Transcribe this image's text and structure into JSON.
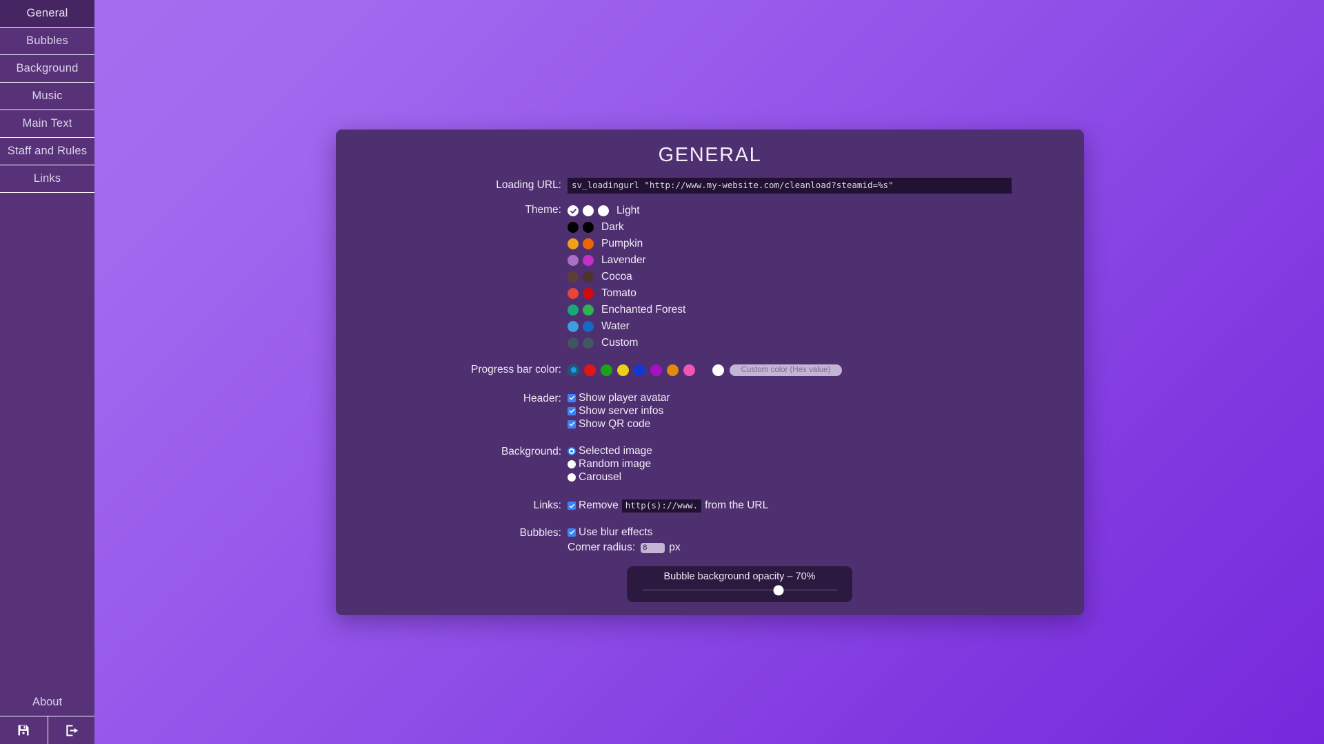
{
  "sidebar": {
    "items": [
      {
        "label": "General",
        "active": true
      },
      {
        "label": "Bubbles",
        "active": false
      },
      {
        "label": "Background",
        "active": false
      },
      {
        "label": "Music",
        "active": false
      },
      {
        "label": "Main Text",
        "active": false
      },
      {
        "label": "Staff and Rules",
        "active": false
      },
      {
        "label": "Links",
        "active": false
      }
    ],
    "about_label": "About",
    "buttons": [
      {
        "icon": "save-icon",
        "name": "save-button"
      },
      {
        "icon": "exit-icon",
        "name": "exit-button"
      }
    ]
  },
  "panel": {
    "title": "GENERAL",
    "loading_url": {
      "label": "Loading URL:",
      "value": "sv_loadingurl \"http://www.my-website.com/cleanload?steamid=%s\""
    },
    "theme": {
      "label": "Theme:",
      "options": [
        {
          "name": "Light",
          "selected": true,
          "colors": [
            "#ffffff",
            "#ffffff",
            "#ffffff"
          ]
        },
        {
          "name": "Dark",
          "selected": false,
          "colors": [
            "#000000",
            "#000000"
          ]
        },
        {
          "name": "Pumpkin",
          "selected": false,
          "colors": [
            "#f0a019",
            "#ec6605"
          ]
        },
        {
          "name": "Lavender",
          "selected": false,
          "colors": [
            "#ab6fc7",
            "#c230c9"
          ]
        },
        {
          "name": "Cocoa",
          "selected": false,
          "colors": [
            "#5c3f35",
            "#4c342c"
          ]
        },
        {
          "name": "Tomato",
          "selected": false,
          "colors": [
            "#e8443c",
            "#d60909"
          ]
        },
        {
          "name": "Enchanted Forest",
          "selected": false,
          "colors": [
            "#19a977",
            "#2fb34f"
          ]
        },
        {
          "name": "Water",
          "selected": false,
          "colors": [
            "#3f9ee0",
            "#1369c4"
          ]
        },
        {
          "name": "Custom",
          "selected": false,
          "colors": [
            "#41565f",
            "#42575f"
          ]
        }
      ]
    },
    "progress_bar": {
      "label": "Progress bar color:",
      "colors": [
        {
          "hex": "#1a5e75",
          "selected": true,
          "inner": "#2196f3"
        },
        {
          "hex": "#e31515",
          "selected": false
        },
        {
          "hex": "#18a318",
          "selected": false
        },
        {
          "hex": "#ead119",
          "selected": false
        },
        {
          "hex": "#1238d4",
          "selected": false
        },
        {
          "hex": "#a711c4",
          "selected": false
        },
        {
          "hex": "#e08a0a",
          "selected": false
        },
        {
          "hex": "#f256b4",
          "selected": false
        }
      ],
      "white_swatch": "#ffffff",
      "custom_placeholder": "Custom color (Hex value)",
      "custom_value": ""
    },
    "header": {
      "label": "Header:",
      "options": [
        {
          "label": "Show player avatar",
          "checked": true
        },
        {
          "label": "Show server infos",
          "checked": true
        },
        {
          "label": "Show QR code",
          "checked": true
        }
      ]
    },
    "background": {
      "label": "Background:",
      "options": [
        {
          "label": "Selected image",
          "selected": true
        },
        {
          "label": "Random image",
          "selected": false
        },
        {
          "label": "Carousel",
          "selected": false
        }
      ]
    },
    "links": {
      "label": "Links:",
      "checked": true,
      "text_before": "Remove",
      "code": "http(s)://www.",
      "text_after": "from the URL"
    },
    "bubbles": {
      "label": "Bubbles:",
      "blur_label": "Use blur effects",
      "blur_checked": true,
      "radius_label": "Corner radius:",
      "radius_value": "8",
      "radius_unit": "px",
      "opacity_label": "Bubble background opacity – 70%",
      "opacity_percent": 70
    }
  },
  "colors": {
    "sidebar_bg": "#573278",
    "sidebar_active": "#452562",
    "panel_bg": "#4e3070",
    "code_bg": "#211233",
    "accent_blue": "#3b82f6",
    "bg_gradient_start": "#a96ff0",
    "bg_gradient_end": "#7629dc"
  }
}
